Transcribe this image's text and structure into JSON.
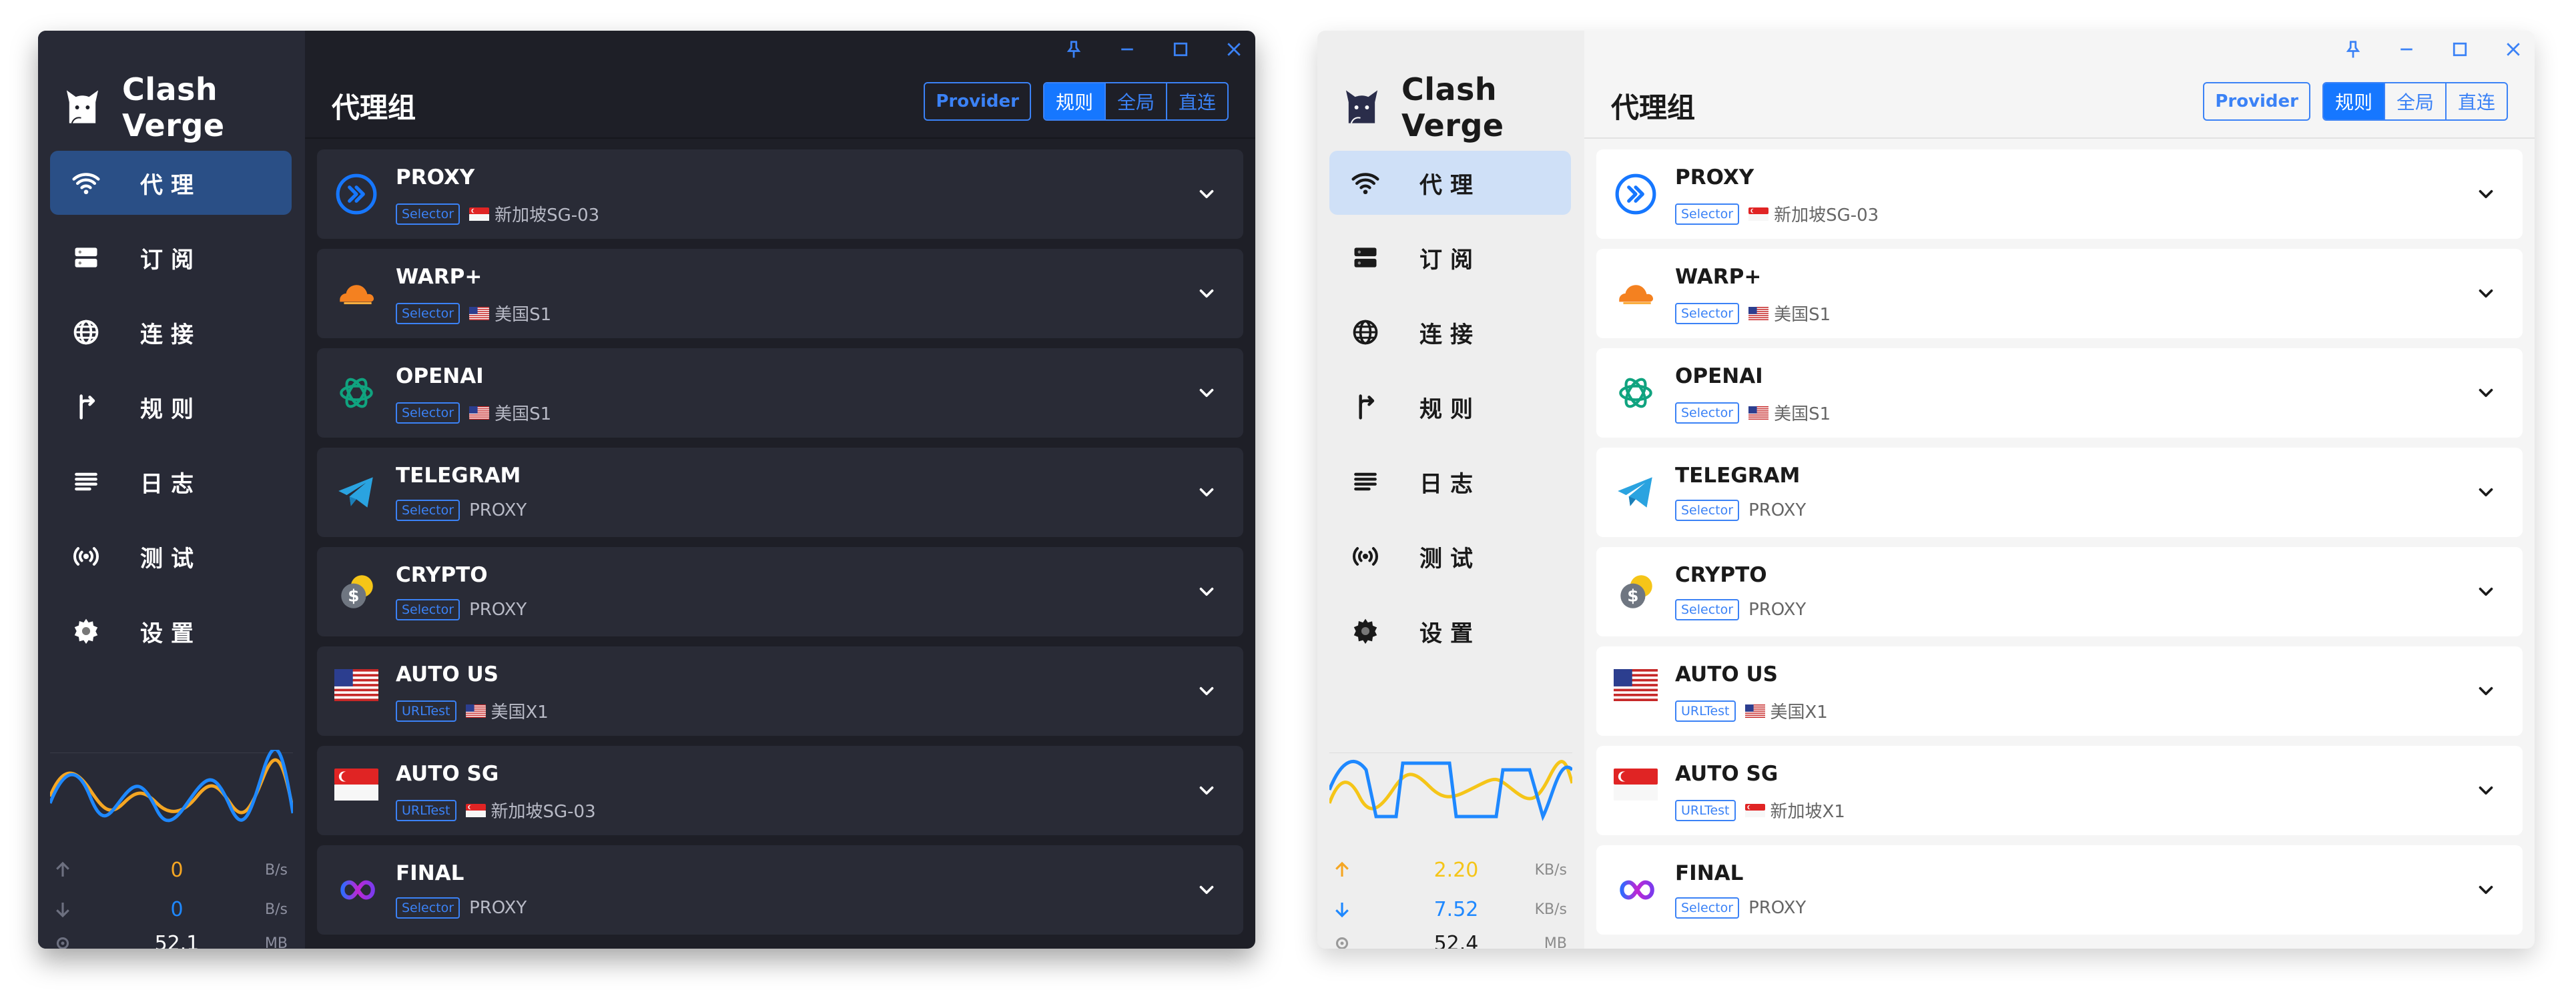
{
  "colors": {
    "accent": "#1677ff",
    "accent_outline": "#3b82f6",
    "upload_orange": "#f5a623",
    "download_blue": "#1e88ff",
    "dark_background": "#1e1f27",
    "dark_sidebar": "#282a36",
    "dark_card": "#292b36",
    "light_background": "#f5f5f5",
    "light_card": "#ffffff"
  },
  "windows": [
    {
      "theme": "dark",
      "app": {
        "name": "Clash Verge",
        "logo_icon": "cat-icon"
      },
      "page": {
        "title": "代理组"
      },
      "header": {
        "provider_label": "Provider",
        "modes": [
          {
            "label": "规则",
            "active": true
          },
          {
            "label": "全局",
            "active": false
          },
          {
            "label": "直连",
            "active": false
          }
        ]
      },
      "nav": [
        {
          "label": "代理",
          "icon": "wifi-icon",
          "active": true
        },
        {
          "label": "订阅",
          "icon": "server-icon",
          "active": false
        },
        {
          "label": "连接",
          "icon": "globe-icon",
          "active": false
        },
        {
          "label": "规则",
          "icon": "fork-arrow-icon",
          "active": false
        },
        {
          "label": "日志",
          "icon": "lines-icon",
          "active": false
        },
        {
          "label": "测试",
          "icon": "broadcast-icon",
          "active": false
        },
        {
          "label": "设置",
          "icon": "gear-icon",
          "active": false
        }
      ],
      "traffic": {
        "upload": {
          "value": "0",
          "unit": "B/s"
        },
        "download": {
          "value": "0",
          "unit": "B/s"
        },
        "memory": {
          "value": "52.1",
          "unit": "MB"
        }
      },
      "groups": [
        {
          "name": "PROXY",
          "type": "Selector",
          "now": "新加坡SG-03",
          "now_flag": "sg",
          "icon": "proxy-icon"
        },
        {
          "name": "WARP+",
          "type": "Selector",
          "now": "美国S1",
          "now_flag": "us",
          "icon": "cloudflare-icon"
        },
        {
          "name": "OPENAI",
          "type": "Selector",
          "now": "美国S1",
          "now_flag": "us",
          "icon": "openai-icon"
        },
        {
          "name": "TELEGRAM",
          "type": "Selector",
          "now": "PROXY",
          "now_flag": "",
          "icon": "telegram-icon"
        },
        {
          "name": "CRYPTO",
          "type": "Selector",
          "now": "PROXY",
          "now_flag": "",
          "icon": "crypto-icon"
        },
        {
          "name": "AUTO US",
          "type": "URLTest",
          "now": "美国X1",
          "now_flag": "us",
          "icon": "us-flag-icon"
        },
        {
          "name": "AUTO SG",
          "type": "URLTest",
          "now": "新加坡SG-03",
          "now_flag": "sg",
          "icon": "sg-flag-icon"
        },
        {
          "name": "FINAL",
          "type": "Selector",
          "now": "PROXY",
          "now_flag": "",
          "icon": "infinity-icon"
        }
      ]
    },
    {
      "theme": "light",
      "app": {
        "name": "Clash Verge",
        "logo_icon": "cat-icon"
      },
      "page": {
        "title": "代理组"
      },
      "header": {
        "provider_label": "Provider",
        "modes": [
          {
            "label": "规则",
            "active": true
          },
          {
            "label": "全局",
            "active": false
          },
          {
            "label": "直连",
            "active": false
          }
        ]
      },
      "nav": [
        {
          "label": "代理",
          "icon": "wifi-icon",
          "active": true
        },
        {
          "label": "订阅",
          "icon": "server-icon",
          "active": false
        },
        {
          "label": "连接",
          "icon": "globe-icon",
          "active": false
        },
        {
          "label": "规则",
          "icon": "fork-arrow-icon",
          "active": false
        },
        {
          "label": "日志",
          "icon": "lines-icon",
          "active": false
        },
        {
          "label": "测试",
          "icon": "broadcast-icon",
          "active": false
        },
        {
          "label": "设置",
          "icon": "gear-icon",
          "active": false
        }
      ],
      "traffic": {
        "upload": {
          "value": "2.20",
          "unit": "KB/s"
        },
        "download": {
          "value": "7.52",
          "unit": "KB/s"
        },
        "memory": {
          "value": "52.4",
          "unit": "MB"
        }
      },
      "groups": [
        {
          "name": "PROXY",
          "type": "Selector",
          "now": "新加坡SG-03",
          "now_flag": "sg",
          "icon": "proxy-icon"
        },
        {
          "name": "WARP+",
          "type": "Selector",
          "now": "美国S1",
          "now_flag": "us",
          "icon": "cloudflare-icon"
        },
        {
          "name": "OPENAI",
          "type": "Selector",
          "now": "美国S1",
          "now_flag": "us",
          "icon": "openai-icon"
        },
        {
          "name": "TELEGRAM",
          "type": "Selector",
          "now": "PROXY",
          "now_flag": "",
          "icon": "telegram-icon"
        },
        {
          "name": "CRYPTO",
          "type": "Selector",
          "now": "PROXY",
          "now_flag": "",
          "icon": "crypto-icon"
        },
        {
          "name": "AUTO US",
          "type": "URLTest",
          "now": "美国X1",
          "now_flag": "us",
          "icon": "us-flag-icon"
        },
        {
          "name": "AUTO SG",
          "type": "URLTest",
          "now": "新加坡X1",
          "now_flag": "sg",
          "icon": "sg-flag-icon"
        },
        {
          "name": "FINAL",
          "type": "Selector",
          "now": "PROXY",
          "now_flag": "",
          "icon": "infinity-icon"
        }
      ]
    }
  ]
}
